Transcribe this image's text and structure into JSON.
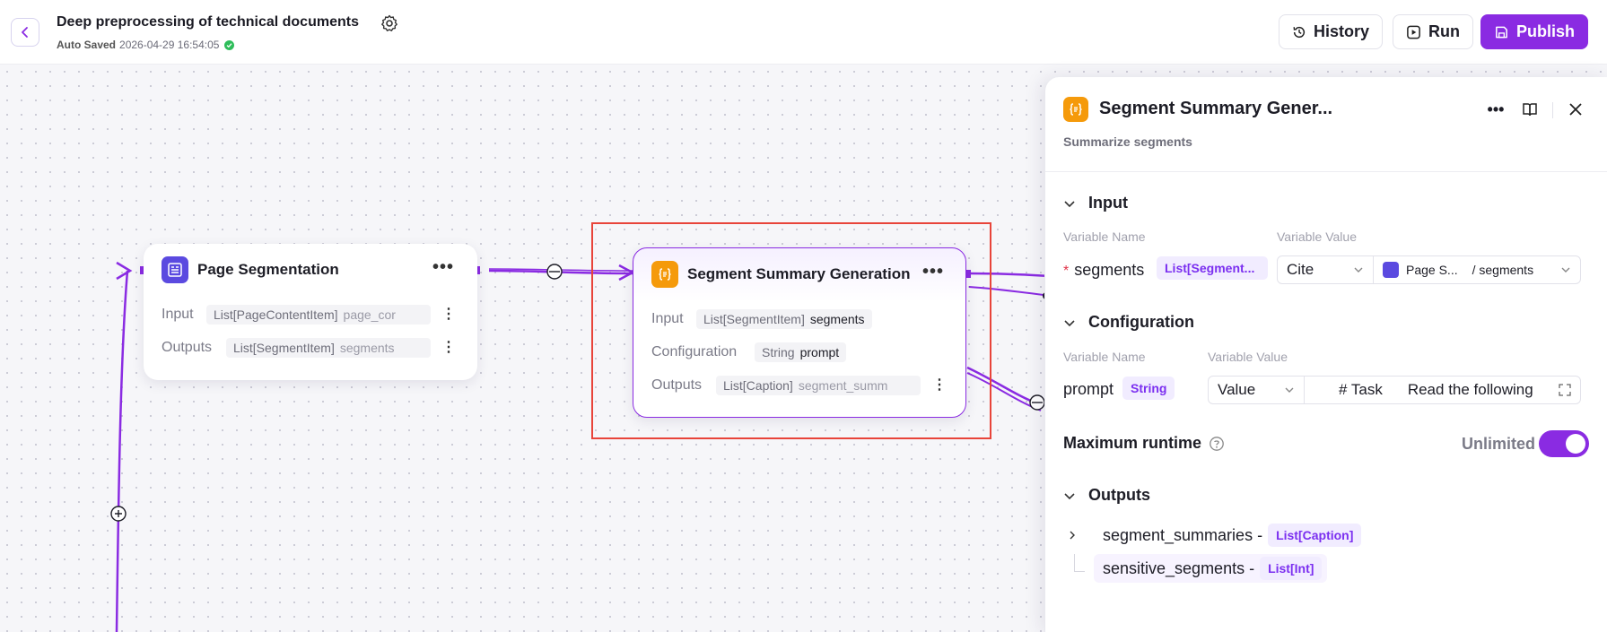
{
  "header": {
    "title": "Deep preprocessing of technical documents",
    "autosave_label": "Auto Saved",
    "autosave_time": "2026-04-29 16:54:05",
    "history_label": "History",
    "run_label": "Run",
    "publish_label": "Publish",
    "accent_color": "#8a2be2"
  },
  "nodes": {
    "page_segmentation": {
      "title": "Page Segmentation",
      "input_label": "Input",
      "input_type": "List[PageContentItem]",
      "input_name": "page_cor",
      "outputs_label": "Outputs",
      "outputs_type": "List[SegmentItem]",
      "outputs_name": "segments"
    },
    "segment_summary": {
      "title": "Segment Summary Generation",
      "input_label": "Input",
      "input_type": "List[SegmentItem]",
      "input_name": "segments",
      "config_label": "Configuration",
      "config_type": "String",
      "config_name": "prompt",
      "outputs_label": "Outputs",
      "outputs_type": "List[Caption]",
      "outputs_name": "segment_summ"
    }
  },
  "panel": {
    "title": "Segment Summary Gener...",
    "subtitle": "Summarize segments",
    "input_section": "Input",
    "col_var_name": "Variable Name",
    "col_var_value": "Variable Value",
    "input_var_name": "segments",
    "input_var_type": "List[Segment...",
    "input_mode": "Cite",
    "input_ref_node": "Page S...",
    "input_ref_var": "/ segments",
    "config_section": "Configuration",
    "config_var_name": "prompt",
    "config_var_type": "String",
    "config_mode": "Value",
    "config_value_head": "# Task",
    "config_value_text": "Read the following",
    "max_runtime_label": "Maximum runtime",
    "max_runtime_value": "Unlimited",
    "max_runtime_enabled": true,
    "outputs_section": "Outputs",
    "outputs": [
      {
        "name": "segment_summaries -",
        "type": "List[Caption]"
      },
      {
        "name": "sensitive_segments -",
        "type": "List[Int]"
      }
    ]
  }
}
